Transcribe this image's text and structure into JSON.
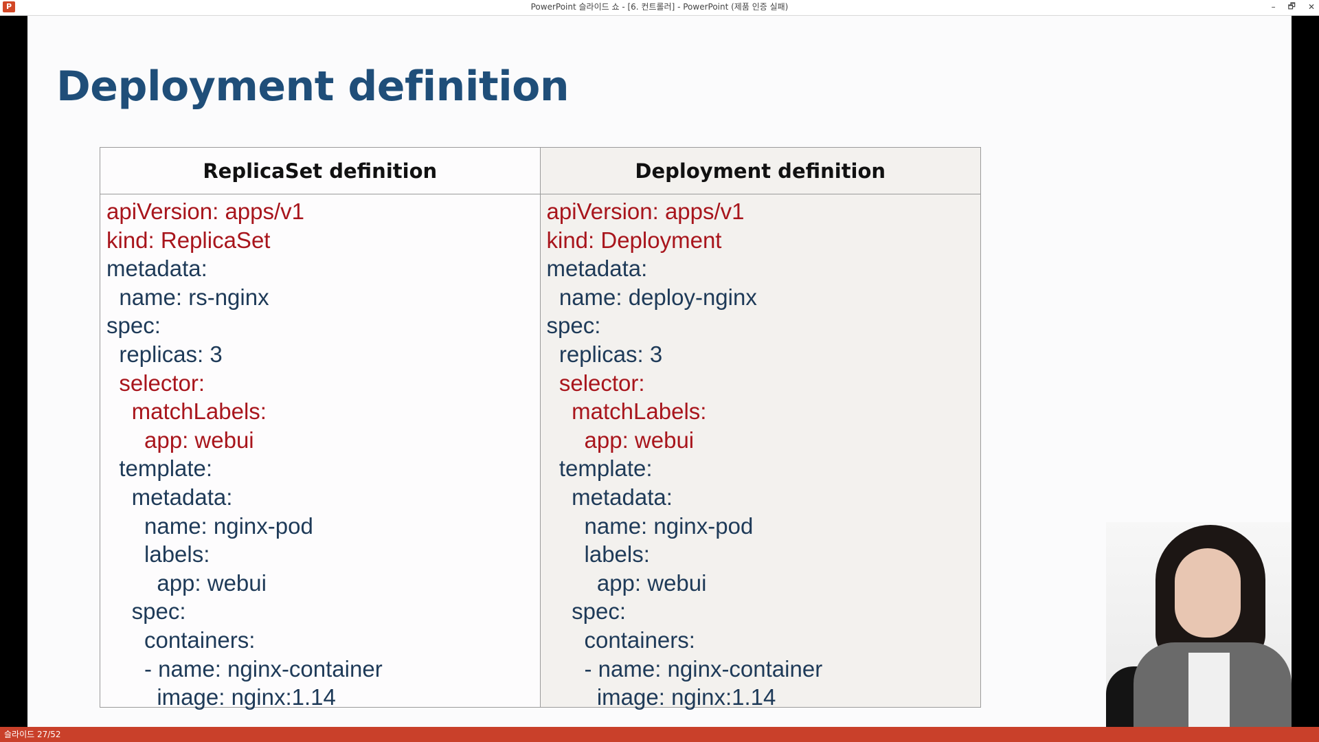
{
  "window": {
    "title": "PowerPoint 슬라이드 쇼 - [6. 컨트롤러] - PowerPoint (제품 인증 실패)",
    "app_icon": "P",
    "controls": {
      "minimize": "–",
      "restore": "🗗",
      "close": "✕"
    }
  },
  "slide": {
    "title": "Deployment definition",
    "left_header": "ReplicaSet definition",
    "right_header": "Deployment definition",
    "left_lines": [
      {
        "text": "apiVersion: apps/v1",
        "color": "red"
      },
      {
        "text": "kind: ReplicaSet",
        "color": "red"
      },
      {
        "text": "metadata:",
        "color": "blue"
      },
      {
        "text": "  name: rs-nginx",
        "color": "blue"
      },
      {
        "text": "spec:",
        "color": "blue"
      },
      {
        "text": "  replicas: 3",
        "color": "blue"
      },
      {
        "text": "  selector:",
        "color": "red"
      },
      {
        "text": "    matchLabels:",
        "color": "red"
      },
      {
        "text": "      app: webui",
        "color": "red"
      },
      {
        "text": "  template:",
        "color": "blue"
      },
      {
        "text": "    metadata:",
        "color": "blue"
      },
      {
        "text": "      name: nginx-pod",
        "color": "blue"
      },
      {
        "text": "      labels:",
        "color": "blue"
      },
      {
        "text": "        app: webui",
        "color": "blue"
      },
      {
        "text": "    spec:",
        "color": "blue"
      },
      {
        "text": "      containers:",
        "color": "blue"
      },
      {
        "text": "      - name: nginx-container",
        "color": "blue"
      },
      {
        "text": "        image: nginx:1.14",
        "color": "blue"
      }
    ],
    "right_lines": [
      {
        "text": "apiVersion: apps/v1",
        "color": "red"
      },
      {
        "text": "kind: Deployment",
        "color": "red"
      },
      {
        "text": "metadata:",
        "color": "blue"
      },
      {
        "text": "  name: deploy-nginx",
        "color": "blue"
      },
      {
        "text": "spec:",
        "color": "blue"
      },
      {
        "text": "  replicas: 3",
        "color": "blue"
      },
      {
        "text": "  selector:",
        "color": "red"
      },
      {
        "text": "    matchLabels:",
        "color": "red"
      },
      {
        "text": "      app: webui",
        "color": "red"
      },
      {
        "text": "  template:",
        "color": "blue"
      },
      {
        "text": "    metadata:",
        "color": "blue"
      },
      {
        "text": "      name: nginx-pod",
        "color": "blue"
      },
      {
        "text": "      labels:",
        "color": "blue"
      },
      {
        "text": "        app: webui",
        "color": "blue"
      },
      {
        "text": "    spec:",
        "color": "blue"
      },
      {
        "text": "      containers:",
        "color": "blue"
      },
      {
        "text": "      - name: nginx-container",
        "color": "blue"
      },
      {
        "text": "        image: nginx:1.14",
        "color": "blue"
      }
    ]
  },
  "status": {
    "slide_counter": "슬라이드 27/52"
  },
  "colors": {
    "title": "#1f4e79",
    "code_red": "#a8151c",
    "code_blue": "#1e3a58",
    "statusbar": "#c9402a"
  }
}
